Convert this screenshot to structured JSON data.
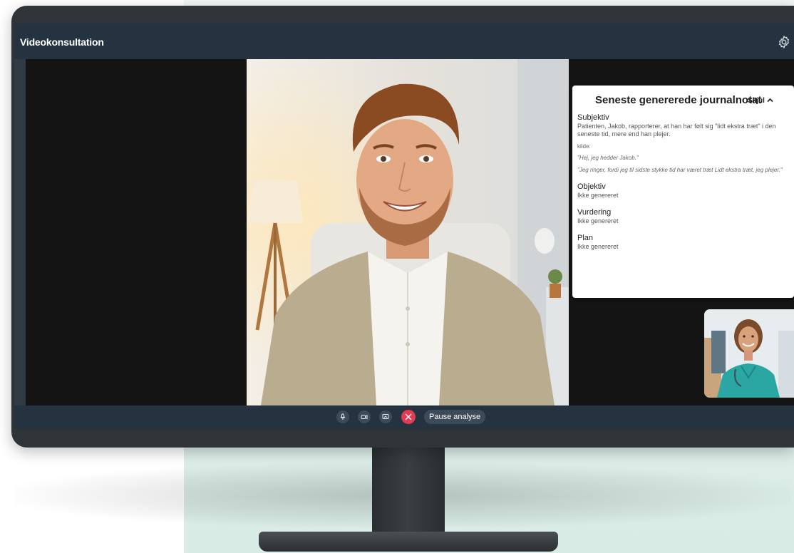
{
  "app": {
    "title": "Videokonsultation"
  },
  "icons": {
    "settings": "gear-icon",
    "mic": "microphone-icon",
    "camera": "camera-icon",
    "screen": "screen-share-icon",
    "hangup": "close-icon",
    "collapse": "chevron-up-icon"
  },
  "controls": {
    "pause_label": "Pause analyse"
  },
  "note": {
    "title": "Seneste genererede journalnotat",
    "hide_label": "Skjul",
    "subjective": {
      "heading": "Subjektiv",
      "text": "Patienten, Jakob, rapporterer, at han har følt sig \"lidt ekstra træt\" i den seneste tid, mere end han plejer.",
      "source_label": "kilde:",
      "quotes": [
        "\"Hej, jeg hedder Jakob.\"",
        "\"Jeg ringer, fordi jeg til sidste stykke tid har været træt Lidt ekstra træt, jeg plejer.\""
      ]
    },
    "objective": {
      "heading": "Objektiv",
      "text": "Ikke genereret"
    },
    "assessment": {
      "heading": "Vurdering",
      "text": "Ikke genereret"
    },
    "plan": {
      "heading": "Plan",
      "text": "Ikke genereret"
    }
  },
  "colors": {
    "titlebar": "#253340",
    "accent_hangup": "#e33b54",
    "control_button": "#3d4b58"
  }
}
